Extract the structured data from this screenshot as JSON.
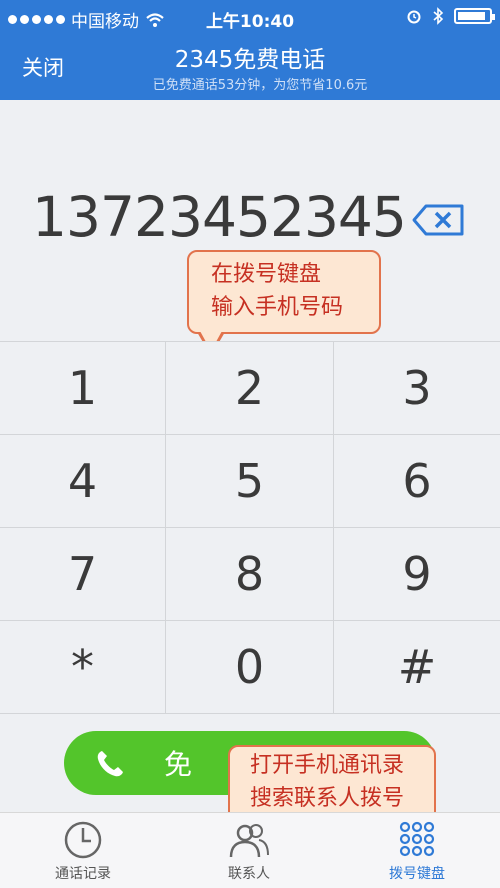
{
  "status_bar": {
    "carrier": "中国移动",
    "time": "上午10:40"
  },
  "header": {
    "close_label": "关闭",
    "title": "2345免费电话",
    "subtitle": "已免费通话53分钟，为您节省10.6元"
  },
  "dialer": {
    "number": "13723452345"
  },
  "annotations": {
    "keypad_tip_line1": "在拨号键盘",
    "keypad_tip_line2": "输入手机号码",
    "contacts_tip_line1": "打开手机通讯录",
    "contacts_tip_line2": "搜索联系人拨号"
  },
  "keypad": [
    "1",
    "2",
    "3",
    "4",
    "5",
    "6",
    "7",
    "8",
    "9",
    "*",
    "0",
    "#"
  ],
  "call_button": {
    "label": "免"
  },
  "tabs": [
    {
      "label": "通话记录",
      "icon": "clock-icon"
    },
    {
      "label": "联系人",
      "icon": "contacts-icon"
    },
    {
      "label": "拨号键盘",
      "icon": "dialpad-icon",
      "active": true
    }
  ],
  "colors": {
    "header_bg": "#2f7ad6",
    "call_green": "#53c52b",
    "callout_border": "#e2734c",
    "callout_text": "#c63022"
  }
}
